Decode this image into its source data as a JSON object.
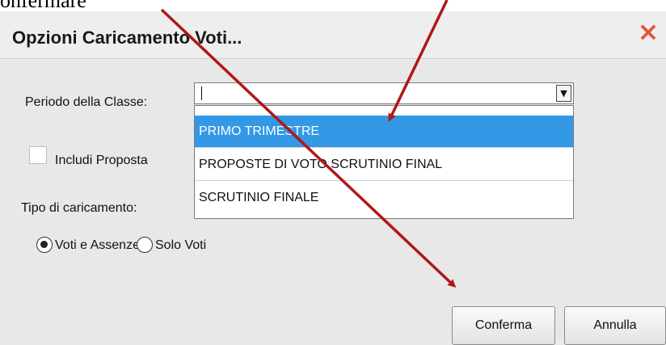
{
  "caption": {
    "text": "onfermare"
  },
  "dialog": {
    "title": "Opzioni Caricamento Voti...",
    "close_symbol": "×",
    "periodo_label": "Periodo della Classe:",
    "select_value": "",
    "select_arrow": "▼",
    "options": [
      "PRIMO TRIMESTRE",
      "PROPOSTE DI VOTO SCRUTINIO FINAL",
      "SCRUTINIO FINALE"
    ],
    "includi_label": "Includi Proposta",
    "tipo_label": "Tipo di caricamento:",
    "radio_voti_label": "Voti e Assenze",
    "radio_solo_label": "Solo Voti",
    "conferma_label": "Conferma",
    "annulla_label": "Annulla"
  },
  "colors": {
    "highlight": "#3399e6",
    "arrow": "#b01818",
    "close": "#e0573a"
  }
}
